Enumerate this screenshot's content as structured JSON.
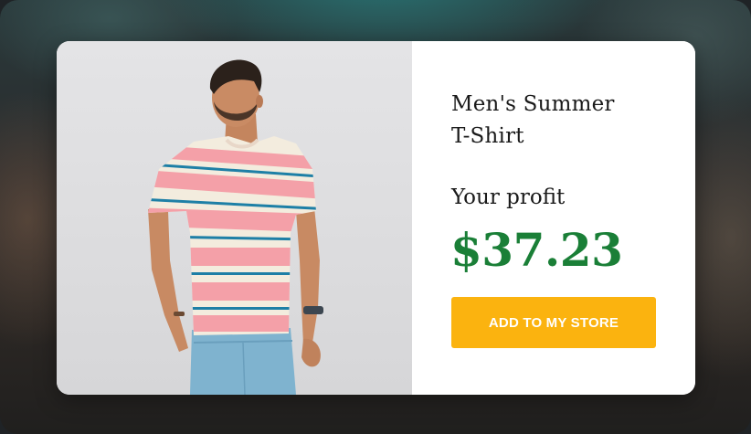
{
  "product": {
    "title_line1": "Men's Summer",
    "title_line2": "T-Shirt",
    "image_alt": "Man wearing a pink, cream and blue striped t-shirt with light blue jeans"
  },
  "profit": {
    "label": "Your profit",
    "value": "$37.23"
  },
  "actions": {
    "add_to_store_label": "ADD TO MY STORE"
  },
  "colors": {
    "profit_green": "#1a7f37",
    "button_orange": "#fbb30f",
    "button_text": "#ffffff",
    "card_background": "#ffffff",
    "shirt_pink": "#f4a0a8",
    "shirt_cream": "#f3ecde",
    "shirt_stripe_blue": "#1e7fa6",
    "jeans_blue": "#7fb3cf"
  }
}
